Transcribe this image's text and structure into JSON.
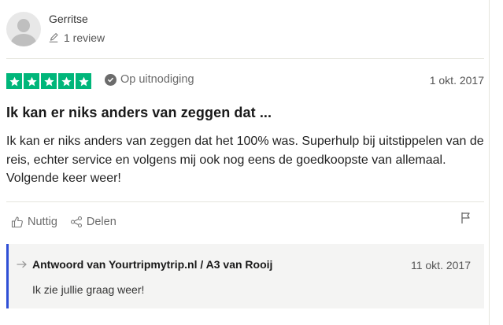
{
  "reviewer": {
    "name": "Gerritse",
    "review_count": "1 review"
  },
  "rating": {
    "stars": 5,
    "max_stars": 5,
    "star_color": "#00b67a",
    "invite_label": "Op uitnodiging",
    "date": "1 okt. 2017"
  },
  "review": {
    "title": "Ik kan er niks anders van zeggen dat ...",
    "body": "Ik kan er niks anders van zeggen dat het 100% was. Superhulp bij uitstippelen van de reis, echter service en volgens mij ook nog eens de goedkoopste van allemaal. Volgende keer weer!"
  },
  "actions": {
    "useful_label": "Nuttig",
    "share_label": "Delen",
    "report_icon": "flag-icon"
  },
  "reply": {
    "accent_color": "#2f4fd6",
    "title": "Antwoord van Yourtripmytrip.nl / A3 van Rooij",
    "date": "11 okt. 2017",
    "text": "Ik zie jullie graag weer!"
  }
}
